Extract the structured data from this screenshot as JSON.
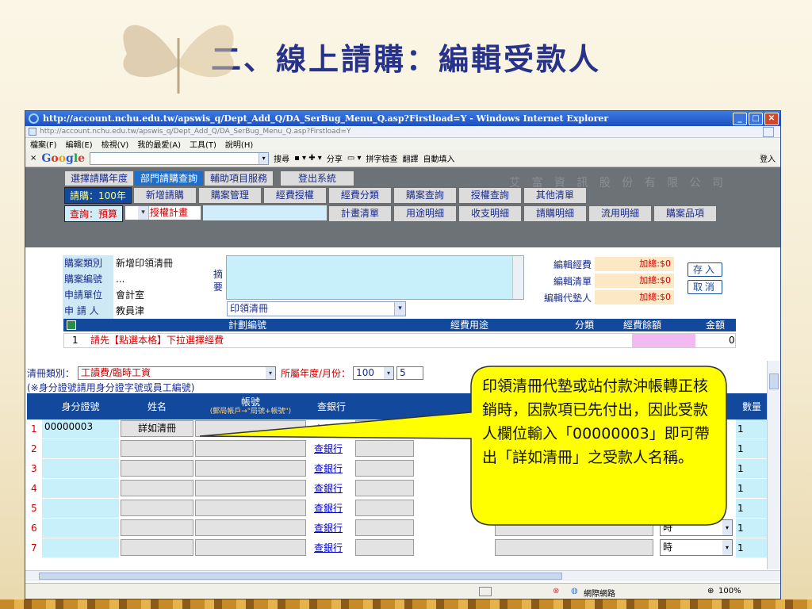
{
  "slide": {
    "title": "二、線上請購：編輯受款人"
  },
  "window": {
    "title": "http://account.nchu.edu.tw/apswis_q/Dept_Add_Q/DA_SerBug_Menu_Q.asp?Firstload=Y - Windows Internet Explorer",
    "address": "http://account.nchu.edu.tw/apswis_q/Dept_Add_Q/DA_SerBug_Menu_Q.asp?Firstload=Y",
    "menu": [
      "檔案(F)",
      "編輯(E)",
      "檢視(V)",
      "我的最愛(A)",
      "工具(T)",
      "說明(H)"
    ],
    "google": {
      "logo": "Google",
      "items": [
        "搜尋",
        "分享",
        "拼字檢查",
        "翻譯",
        "自動填入"
      ],
      "login": "登入"
    }
  },
  "sys": {
    "banner": "艾 富 資 訊 股 份 有 限 公 司",
    "topmenu": [
      "選擇請購年度",
      "部門請購查詢",
      "輔助項目服務",
      "登出系統"
    ],
    "year_label": "請購：100年",
    "row2": [
      "新增請購",
      "購案管理",
      "經費授權",
      "經費分類",
      "購案查詢",
      "授權查詢",
      "其他清單"
    ],
    "query_label": "查詢：預算",
    "query_select": "無授權計畫",
    "row3": [
      "計畫清單",
      "用途明細",
      "收支明細",
      "請購明細",
      "流用明細",
      "購案品項"
    ]
  },
  "case": {
    "fields": [
      {
        "k": "購案類別",
        "v": "新增印領清冊"
      },
      {
        "k": "購案編號",
        "v": "..."
      },
      {
        "k": "申請單位",
        "v": "會計室"
      },
      {
        "k": "申 請 人",
        "v": "教員津"
      }
    ],
    "memo_label": "摘要",
    "combo": "印領清冊",
    "edits": [
      {
        "btn": "編輯經費",
        "amt": "加總:$0"
      },
      {
        "btn": "編輯清單",
        "amt": "加總:$0"
      },
      {
        "btn": "編輯代墊人",
        "amt": "加總:$0"
      }
    ],
    "save": "存入",
    "cancel": "取消"
  },
  "plan": {
    "headers": [
      "計劃編號",
      "經費用途",
      "分類",
      "經費餘額",
      "金額"
    ],
    "row": {
      "no": "1",
      "text": "請先【點選本格】下拉選擇經費",
      "amount": "0"
    }
  },
  "payee": {
    "filter_label": "清冊類別：",
    "filter_value": "工讀費/臨時工資",
    "year_label": "所屬年度/月份：",
    "year": "100",
    "month": "5",
    "note": "(※身分證號請用身分證字號或員工編號)",
    "headers": {
      "id": "身分證號",
      "name": "姓名",
      "acct": "帳號",
      "acct_sub": "(郵局帳戶→\"局號+帳號\")",
      "bank": "查銀行",
      "qty": "數量"
    },
    "rows": [
      {
        "n": "1",
        "id": "00000003",
        "name": "詳如清冊",
        "bank": "查銀行",
        "unit": "",
        "qty": "1"
      },
      {
        "n": "2",
        "id": "",
        "name": "",
        "bank": "查銀行",
        "unit": "",
        "qty": "1"
      },
      {
        "n": "3",
        "id": "",
        "name": "",
        "bank": "查銀行",
        "unit": "",
        "qty": "1"
      },
      {
        "n": "4",
        "id": "",
        "name": "",
        "bank": "查銀行",
        "unit": "",
        "qty": "1"
      },
      {
        "n": "5",
        "id": "",
        "name": "",
        "bank": "查銀行",
        "unit": "",
        "qty": "1"
      },
      {
        "n": "6",
        "id": "",
        "name": "",
        "bank": "查銀行",
        "unit": "時",
        "qty": "1"
      },
      {
        "n": "7",
        "id": "",
        "name": "",
        "bank": "查銀行",
        "unit": "時",
        "qty": "1"
      }
    ]
  },
  "status": {
    "zone": "網際網路",
    "zoom": "100%"
  },
  "callout": {
    "text": "印領清冊代墊或站付款沖帳轉正核銷時，因款項已先付出，因此受款人欄位輸入「00000003」即可帶出「詳如清冊」之受款人名稱。"
  },
  "colors": {
    "title": "#27338a",
    "navy": "#13499c",
    "cyan": "#c8f0fb",
    "callout_fill": "#ffff00",
    "pink": "#f2b9f2"
  }
}
